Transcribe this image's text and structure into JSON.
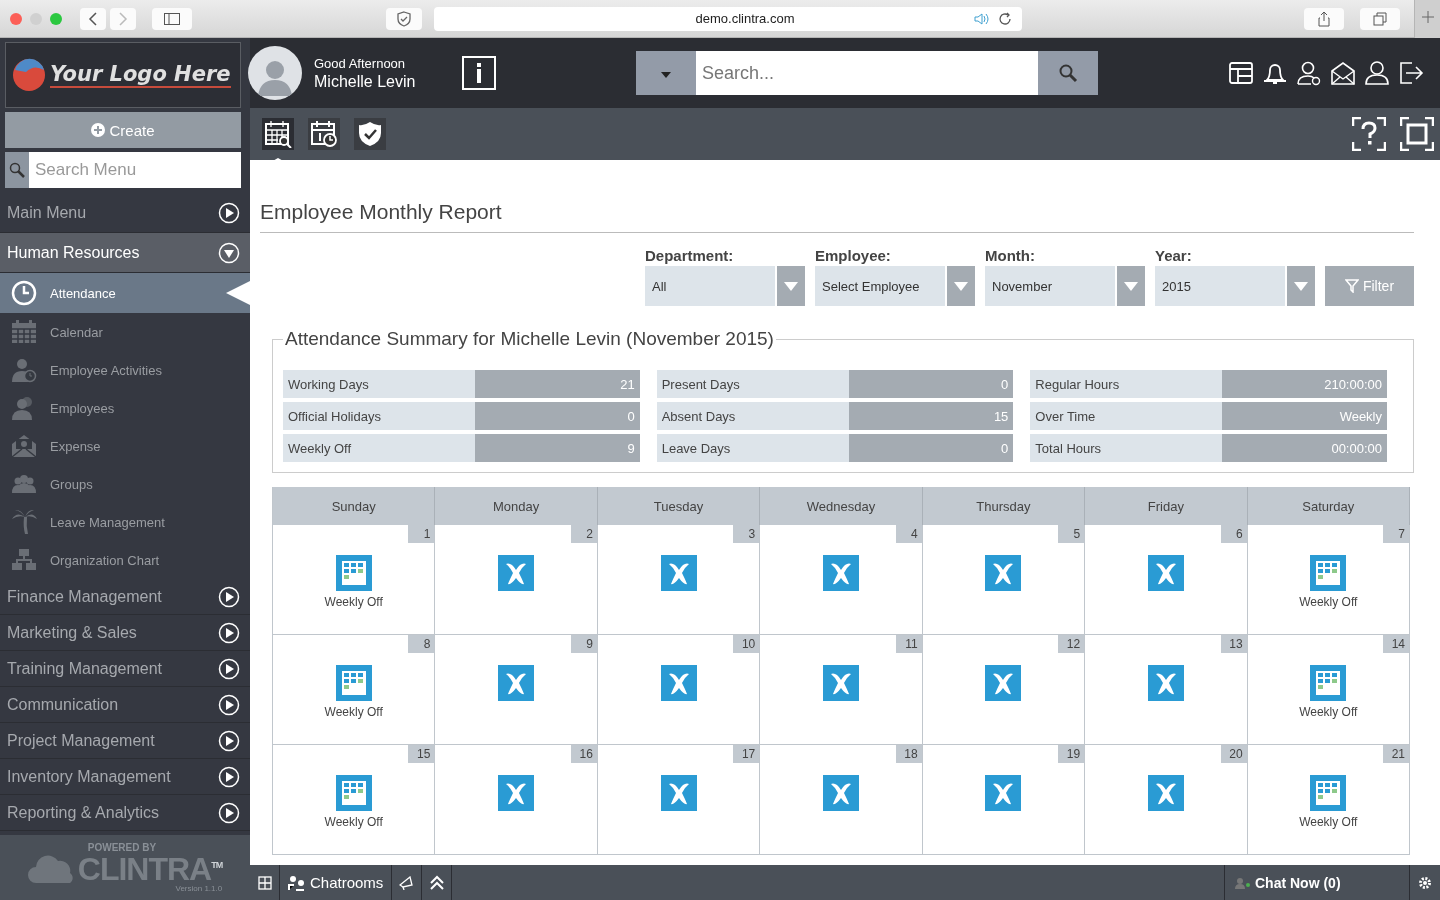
{
  "browser": {
    "url": "demo.clintra.com"
  },
  "logo": {
    "text": "Your Logo Here"
  },
  "create_button": {
    "label": "Create"
  },
  "menu_search": {
    "placeholder": "Search Menu"
  },
  "sidebar": {
    "items": [
      {
        "label": "Main Menu",
        "expanded": false
      },
      {
        "label": "Human Resources",
        "expanded": true,
        "children": [
          {
            "label": "Attendance",
            "selected": true
          },
          {
            "label": "Calendar",
            "selected": false
          },
          {
            "label": "Employee Activities",
            "selected": false
          },
          {
            "label": "Employees",
            "selected": false
          },
          {
            "label": "Expense",
            "selected": false
          },
          {
            "label": "Groups",
            "selected": false
          },
          {
            "label": "Leave Management",
            "selected": false
          },
          {
            "label": "Organization Chart",
            "selected": false
          }
        ]
      },
      {
        "label": "Finance Management",
        "expanded": false
      },
      {
        "label": "Marketing & Sales",
        "expanded": false
      },
      {
        "label": "Training Management",
        "expanded": false
      },
      {
        "label": "Communication",
        "expanded": false
      },
      {
        "label": "Project Management",
        "expanded": false
      },
      {
        "label": "Inventory Management",
        "expanded": false
      },
      {
        "label": "Reporting & Analytics",
        "expanded": false
      }
    ]
  },
  "sidebar_footer": {
    "powered_by": "POWERED BY",
    "brand": "CLINTRA",
    "tm": "TM",
    "version": "Version 1.1.0"
  },
  "header": {
    "greeting": "Good Afternoon",
    "user_name": "Michelle Levin",
    "search_placeholder": "Search..."
  },
  "toolbar": {
    "tabs": [
      {
        "selected": true
      },
      {
        "selected": false
      },
      {
        "selected": false
      }
    ]
  },
  "page_title": "Employee Monthly Report",
  "filters": [
    {
      "label": "Department:",
      "value": "All"
    },
    {
      "label": "Employee:",
      "value": "Select Employee"
    },
    {
      "label": "Month:",
      "value": "November"
    },
    {
      "label": "Year:",
      "value": "2015"
    }
  ],
  "filter_button": {
    "label": "Filter"
  },
  "summary": {
    "title": "Attendance Summary for Michelle Levin (November 2015)",
    "columns": [
      [
        {
          "label": "Working Days",
          "value": "21"
        },
        {
          "label": "Official Holidays",
          "value": "0"
        },
        {
          "label": "Weekly Off",
          "value": "9"
        }
      ],
      [
        {
          "label": "Present Days",
          "value": "0"
        },
        {
          "label": "Absent Days",
          "value": "15"
        },
        {
          "label": "Leave Days",
          "value": "0"
        }
      ],
      [
        {
          "label": "Regular Hours",
          "value": "210:00:00"
        },
        {
          "label": "Over Time",
          "value": "Weekly"
        },
        {
          "label": "Total Hours",
          "value": "00:00:00"
        }
      ]
    ]
  },
  "calendar": {
    "weekdays": [
      "Sunday",
      "Monday",
      "Tuesday",
      "Wednesday",
      "Thursday",
      "Friday",
      "Saturday"
    ],
    "weeks": [
      [
        {
          "day": "1",
          "kind": "weekly_off",
          "label": "Weekly Off"
        },
        {
          "day": "2",
          "kind": "absent"
        },
        {
          "day": "3",
          "kind": "absent"
        },
        {
          "day": "4",
          "kind": "absent"
        },
        {
          "day": "5",
          "kind": "absent"
        },
        {
          "day": "6",
          "kind": "absent"
        },
        {
          "day": "7",
          "kind": "weekly_off",
          "label": "Weekly Off"
        }
      ],
      [
        {
          "day": "8",
          "kind": "weekly_off",
          "label": "Weekly Off"
        },
        {
          "day": "9",
          "kind": "absent"
        },
        {
          "day": "10",
          "kind": "absent"
        },
        {
          "day": "11",
          "kind": "absent"
        },
        {
          "day": "12",
          "kind": "absent"
        },
        {
          "day": "13",
          "kind": "absent"
        },
        {
          "day": "14",
          "kind": "weekly_off",
          "label": "Weekly Off"
        }
      ],
      [
        {
          "day": "15",
          "kind": "weekly_off",
          "label": "Weekly Off"
        },
        {
          "day": "16",
          "kind": "absent"
        },
        {
          "day": "17",
          "kind": "absent"
        },
        {
          "day": "18",
          "kind": "absent"
        },
        {
          "day": "19",
          "kind": "absent"
        },
        {
          "day": "20",
          "kind": "absent"
        },
        {
          "day": "21",
          "kind": "weekly_off",
          "label": "Weekly Off"
        }
      ]
    ]
  },
  "bottom_bar": {
    "chatrooms": "Chatrooms",
    "chat_now": "Chat Now (0)"
  }
}
